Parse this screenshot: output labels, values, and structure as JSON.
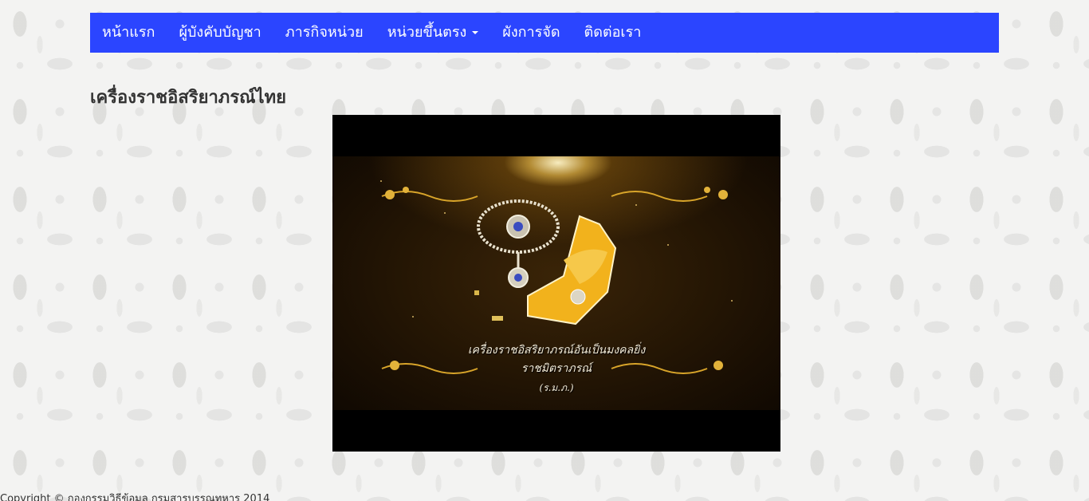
{
  "nav": {
    "items": [
      {
        "label": "หน้าแรก"
      },
      {
        "label": "ผู้บังคับบัญชา"
      },
      {
        "label": "ภารกิจหน่วย"
      },
      {
        "label": "หน่วยขึ้นตรง"
      },
      {
        "label": "ผังการจัด"
      },
      {
        "label": "ติดต่อเรา"
      }
    ],
    "bg_color": "#2b45ff"
  },
  "page": {
    "title": "เครื่องราชอิสริยาภรณ์ไทย"
  },
  "video": {
    "caption_line1": "เครื่องราชอิสริยาภรณ์อันเป็นมงคลยิ่ง",
    "caption_line2": "ราชมิตราภรณ์",
    "caption_line3": "(ร.ม.ภ.)"
  },
  "footer": {
    "text": "Copyright © กองกรรมวิธีข้อมูล กรมสารบรรณทหาร 2014"
  }
}
